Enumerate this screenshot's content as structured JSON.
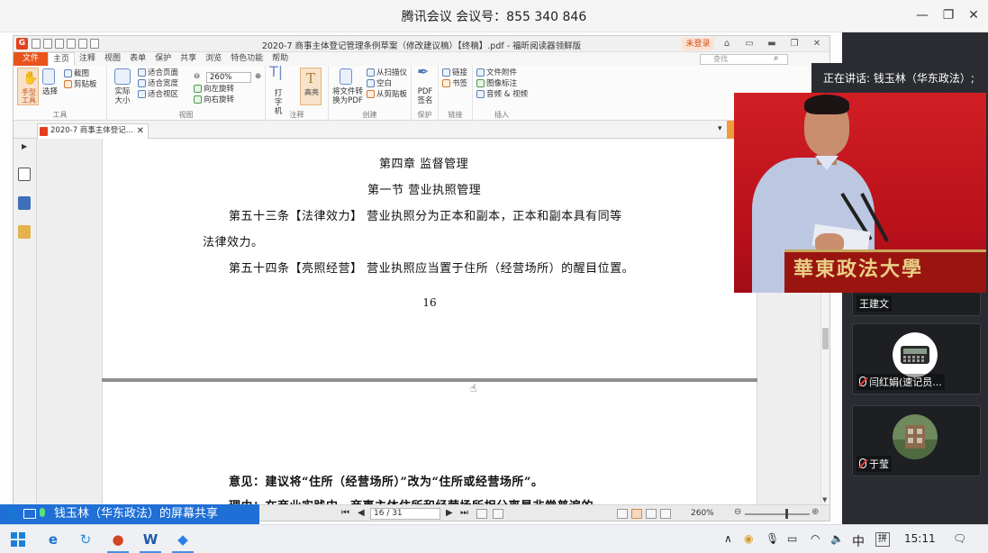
{
  "meeting": {
    "title": "腾讯会议  会议号：855 340 846",
    "minimize": "—",
    "restore": "❐",
    "close": "✕"
  },
  "reader": {
    "doc_title": "2020-7 商事主体登记管理条例草案（修改建议稿）【终稿】.pdf - 福昕阅读器领鲜版",
    "login": "未登录",
    "search_placeholder": "查找",
    "tabs": [
      "文件",
      "主页",
      "注释",
      "视图",
      "表单",
      "保护",
      "共享",
      "浏览",
      "特色功能",
      "帮助"
    ],
    "active_tab": "主页",
    "groups": {
      "tools": {
        "label": "工具",
        "hand": "手型工具",
        "select": "选择",
        "screenshot": "截图",
        "clipboard": "剪贴板"
      },
      "view": {
        "label": "视图",
        "actual": "实际大小",
        "fit_page": "适合页面",
        "fit_width": "适合宽度",
        "fit_visible": "适合视区",
        "zoom": "260%",
        "rotate_left": "向左旋转",
        "rotate_right": "向右旋转"
      },
      "comment": {
        "label": "注释",
        "typewriter": "打字机",
        "highlight": "高亮"
      },
      "create": {
        "label": "创建",
        "convert": "将文件转换为PDF",
        "from_scanner": "从扫描仪",
        "blank": "空白",
        "from_clipboard": "从剪贴板"
      },
      "protect": {
        "label": "保护",
        "sign": "PDF签名"
      },
      "links": {
        "label": "链接",
        "link": "链接",
        "bookmark": "书签"
      },
      "insert": {
        "label": "插入",
        "attachment": "文件附件",
        "image": "图像标注",
        "av": "音频 & 视频"
      }
    },
    "doc_tab": "2020-7 商事主体登记...",
    "page": {
      "chapter": "第四章    监督管理",
      "section": "第一节    营业执照管理",
      "art53_line1": "第五十三条【法律效力】   营业执照分为正本和副本，正本和副本具有同等",
      "art53_line2": "法律效力。",
      "art54": "第五十四条【亮照经营】   营业执照应当置于住所（经营场所）的醒目位置。",
      "page_number": "16",
      "opinion": "意见：建议将“住所（经营场所）”改为“住所或经营场所”。",
      "reason": "理由：在商业实践中，商事主体住所和经营场所相分离是非常普遍的。"
    },
    "status": {
      "page_indicator": "16 / 31",
      "zoom": "260%"
    }
  },
  "share": {
    "label": "钱玉林（华东政法）的屏幕共享"
  },
  "participants": {
    "speaking": "正在讲话: 钱玉林（华东政法）;",
    "tiles": [
      {
        "name": "王建文"
      },
      {
        "name": "闫红娟(速记员..."
      },
      {
        "name": "于莹"
      }
    ]
  },
  "speaker_video": {
    "podium_text": "華東政法大學"
  },
  "taskbar": {
    "ime": "中",
    "ime2": "拼",
    "time": "15:11"
  }
}
